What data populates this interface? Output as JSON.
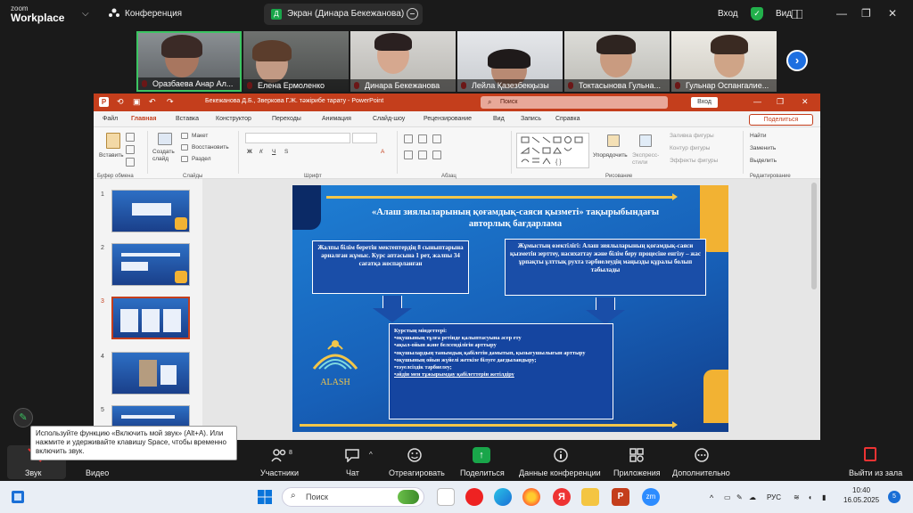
{
  "zoom": {
    "logo_top": "zoom",
    "logo_bottom": "Workplace",
    "meeting": "Конференция",
    "share_title": "Экран (Динара Бекежанова)",
    "login": "Вход",
    "view": "Вид",
    "participants_count": "8",
    "bottom": [
      "Звук",
      "Видео",
      "Участники",
      "Чат",
      "Отреагировать",
      "Поделиться",
      "Данные конференции",
      "Приложения",
      "Дополнительно",
      "Выйти из зала"
    ],
    "tooltip": "Используйте функцию «Включить мой звук» (Alt+A). Или нажмите и удерживайте клавишу Space, чтобы временно включить звук."
  },
  "gallery": [
    {
      "name": "Оразбаева Анар Ал...",
      "active": true
    },
    {
      "name": "Елена Ермоленко"
    },
    {
      "name": "Динара Бекежанова"
    },
    {
      "name": "Лейла Қазезбекқызы"
    },
    {
      "name": "Токтасынова Гульна..."
    },
    {
      "name": "Гульнар Оспангалие..."
    }
  ],
  "ppt": {
    "title": "Бекежанова Д.Б., Зверкова Г.Ж. тәжірибе тарату  -  PowerPoint",
    "search": "Поиск",
    "enter": "Вход",
    "share": "Поделиться",
    "menu": [
      "Файл",
      "Главная",
      "Вставка",
      "Конструктор",
      "Переходы",
      "Анимация",
      "Слайд-шоу",
      "Рецензирование",
      "Вид",
      "Запись",
      "Справка"
    ],
    "ribbon": {
      "paste": "Вставить",
      "create": "Создать слайд",
      "layout": "Макет",
      "reset": "Восстановить",
      "section": "Раздел",
      "arrange": "Упорядочить",
      "styles": "Экспресс-стили",
      "fill": "Заливка фигуры",
      "outline": "Контур фигуры",
      "effects": "Эффекты фигуры",
      "find": "Найти",
      "replace": "Заменить",
      "select": "Выделить",
      "groups": [
        "Буфер обмена",
        "Слайды",
        "Шрифт",
        "Абзац",
        "Рисование",
        "Редактирование"
      ]
    },
    "slide_numbers": [
      "1",
      "2",
      "3",
      "4",
      "5"
    ]
  },
  "slide": {
    "title": "«Алаш зиялыларының қоғамдық-саяси қызметі» тақырыбындағы авторлық бағдарлама",
    "box_left": "Жалпы білім беретін мектептердің 8 сыныптарына арналған жұмыс. Курс аптасына 1 рет, жалпы 34 сағатқа жоспарланған",
    "box_right": "Жұмыстың өзектілігі: Алаш зиялыларының қоғамдық-саяси қызметін зерттеу, насихаттау және білім беру процесіне енгізу – жас ұрпақты ұлттық рухта тәрбиелеудің маңызды құралы болып табылады",
    "tasks_title": "Курстың міндеттері:",
    "tasks": [
      "•оқушының тұлға ретінде қалыптасуына әсер ету",
      "•ақыл-ойын және белсенділігін арттыру",
      "•оқушылардың танымдық қабілетін дамытып, қызығушылығын арттыру",
      "•оқушының ойын жүйелі жеткізе білуге дағдыландыру;",
      "•тәуелсіздік тәрбиелеу;",
      "•әйдін мен тұжырымдау қабілеттерін жетілдіру"
    ],
    "logo_text": "ALASH"
  },
  "taskbar": {
    "search": "Поиск",
    "lang": "РУС",
    "time": "10:40",
    "date": "16.05.2025",
    "notif": "5"
  }
}
